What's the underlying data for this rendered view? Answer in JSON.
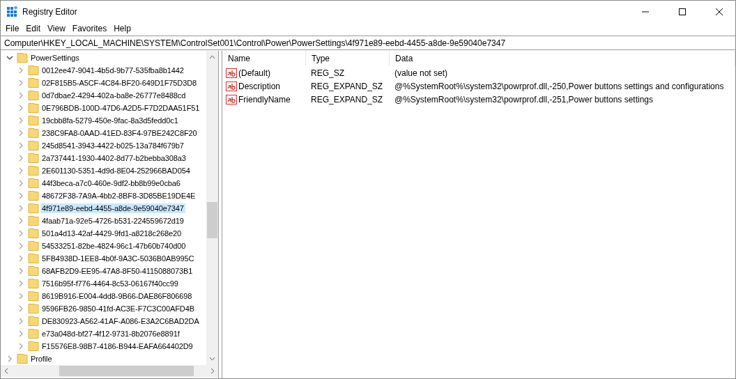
{
  "window": {
    "title": "Registry Editor"
  },
  "menu": [
    "File",
    "Edit",
    "View",
    "Favorites",
    "Help"
  ],
  "address": "Computer\\HKEY_LOCAL_MACHINE\\SYSTEM\\ControlSet001\\Control\\Power\\PowerSettings\\4f971e89-eebd-4455-a8de-9e59040e7347",
  "tree": [
    {
      "label": "PowerSettings",
      "expanded": true,
      "selected": false,
      "children": [
        {
          "label": "0012ee47-9041-4b5d-9b77-535fba8b1442",
          "expanded": false,
          "selected": false
        },
        {
          "label": "02F815B5-A5CF-4C84-BF20-649D1F75D3D8",
          "expanded": false,
          "selected": false
        },
        {
          "label": "0d7dbae2-4294-402a-ba8e-26777e8488cd",
          "expanded": false,
          "selected": false
        },
        {
          "label": "0E796BDB-100D-47D6-A2D5-F7D2DAA51F51",
          "expanded": false,
          "selected": false
        },
        {
          "label": "19cbb8fa-5279-450e-9fac-8a3d5fedd0c1",
          "expanded": false,
          "selected": false
        },
        {
          "label": "238C9FA8-0AAD-41ED-83F4-97BE242C8F20",
          "expanded": false,
          "selected": false
        },
        {
          "label": "245d8541-3943-4422-b025-13a784f679b7",
          "expanded": false,
          "selected": false
        },
        {
          "label": "2a737441-1930-4402-8d77-b2bebba308a3",
          "expanded": false,
          "selected": false
        },
        {
          "label": "2E601130-5351-4d9d-8E04-252966BAD054",
          "expanded": false,
          "selected": false
        },
        {
          "label": "44f3beca-a7c0-460e-9df2-bb8b99e0cba6",
          "expanded": false,
          "selected": false
        },
        {
          "label": "48672F38-7A9A-4bb2-8BF8-3D85BE19DE4E",
          "expanded": false,
          "selected": false
        },
        {
          "label": "4f971e89-eebd-4455-a8de-9e59040e7347",
          "expanded": false,
          "selected": true
        },
        {
          "label": "4faab71a-92e5-4726-b531-224559672d19",
          "expanded": false,
          "selected": false
        },
        {
          "label": "501a4d13-42af-4429-9fd1-a8218c268e20",
          "expanded": false,
          "selected": false
        },
        {
          "label": "54533251-82be-4824-96c1-47b60b740d00",
          "expanded": false,
          "selected": false
        },
        {
          "label": "5FB4938D-1EE8-4b0f-9A3C-5036B0AB995C",
          "expanded": false,
          "selected": false
        },
        {
          "label": "68AFB2D9-EE95-47A8-8F50-4115088073B1",
          "expanded": false,
          "selected": false
        },
        {
          "label": "7516b95f-f776-4464-8c53-06167f40cc99",
          "expanded": false,
          "selected": false
        },
        {
          "label": "8619B916-E004-4dd8-9B66-DAE86F806698",
          "expanded": false,
          "selected": false
        },
        {
          "label": "9596FB26-9850-41fd-AC3E-F7C3C00AFD4B",
          "expanded": false,
          "selected": false
        },
        {
          "label": "DE830923-A562-41AF-A086-E3A2C6BAD2DA",
          "expanded": false,
          "selected": false
        },
        {
          "label": "e73a048d-bf27-4f12-9731-8b2076e8891f",
          "expanded": false,
          "selected": false
        },
        {
          "label": "F15576E8-98B7-4186-B944-EAFA664402D9",
          "expanded": false,
          "selected": false
        }
      ]
    },
    {
      "label": "Profile",
      "expanded": false,
      "selected": false
    }
  ],
  "table": {
    "columns": [
      "Name",
      "Type",
      "Data"
    ],
    "rows": [
      {
        "name": "(Default)",
        "type": "REG_SZ",
        "data": "(value not set)"
      },
      {
        "name": "Description",
        "type": "REG_EXPAND_SZ",
        "data": "@%SystemRoot%\\system32\\powrprof.dll,-250,Power buttons settings and configurations"
      },
      {
        "name": "FriendlyName",
        "type": "REG_EXPAND_SZ",
        "data": "@%SystemRoot%\\system32\\powrprof.dll,-251,Power buttons settings"
      }
    ]
  }
}
